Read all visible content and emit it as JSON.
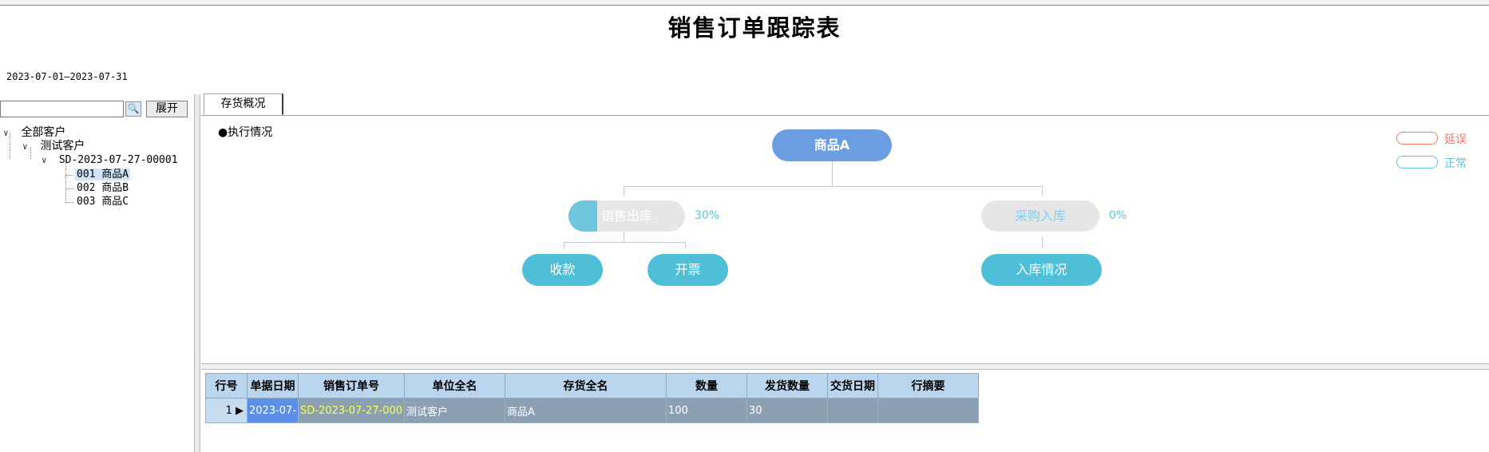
{
  "report": {
    "title": "销售订单跟踪表",
    "period": "2023-07-01—2023-07-31"
  },
  "left_panel": {
    "search_placeholder": "",
    "expand_label": "展开",
    "tree": {
      "root": "全部客户",
      "customer": "测试客户",
      "order": "SD-2023-07-27-00001",
      "items": [
        "001 商品A",
        "002 商品B",
        "003 商品C"
      ],
      "selected_index": 0
    }
  },
  "tabs": [
    {
      "label": "存货概况",
      "active": true
    }
  ],
  "diagram": {
    "section_label": "●执行情况",
    "root_node": "商品A",
    "sales_out": {
      "label": "销售出库",
      "percent_text": "30%",
      "progress": 0.3
    },
    "purchase_in": {
      "label": "采购入库",
      "percent_text": "0%",
      "progress": 0
    },
    "collect": "收款",
    "invoice": "开票",
    "stock_in_status": "入库情况",
    "legend": [
      {
        "label": "延误",
        "color": "#f07c6c"
      },
      {
        "label": "正常",
        "color": "#5ec3dc"
      }
    ]
  },
  "grid": {
    "columns": [
      "行号",
      "单据日期",
      "销售订单号",
      "单位全名",
      "存货全名",
      "数量",
      "发货数量",
      "交货日期",
      "行摘要"
    ],
    "rows": [
      [
        "1",
        "2023-07-",
        "SD-2023-07-27-000",
        "测试客户",
        "商品A",
        "100",
        "30",
        "",
        ""
      ]
    ]
  },
  "colors": {
    "root_node": "#6b9ee0",
    "teal_node": "#4fbfd8",
    "header_bg": "#bad6ee",
    "row_bg": "#8ca0b4"
  }
}
